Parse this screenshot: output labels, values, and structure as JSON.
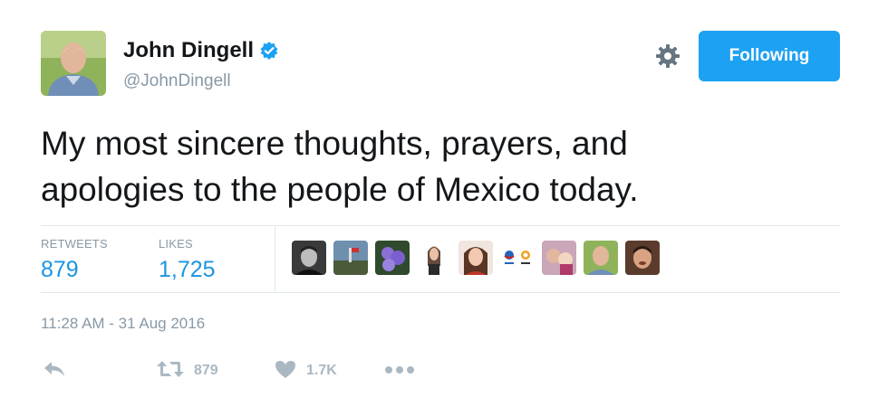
{
  "author": {
    "name": "John Dingell",
    "handle": "@JohnDingell"
  },
  "follow_button": {
    "label": "Following"
  },
  "tweet": {
    "text_line1": "My most sincere thoughts, prayers, and",
    "text_line2": "apologies to the people of Mexico today."
  },
  "stats": {
    "retweets_label": "RETWEETS",
    "retweets_value": "879",
    "likes_label": "LIKES",
    "likes_value": "1,725"
  },
  "timestamp": "11:28 AM - 31 Aug 2016",
  "actions": {
    "retweet_count": "879",
    "like_count": "1.7K"
  },
  "colors": {
    "accent": "#1da1f2",
    "link": "#1b95e0",
    "muted": "#8899a6",
    "icon": "#aab8c2"
  },
  "icons": [
    "verified-badge-icon",
    "gear-icon",
    "reply-icon",
    "retweet-icon",
    "heart-icon",
    "more-icon"
  ]
}
